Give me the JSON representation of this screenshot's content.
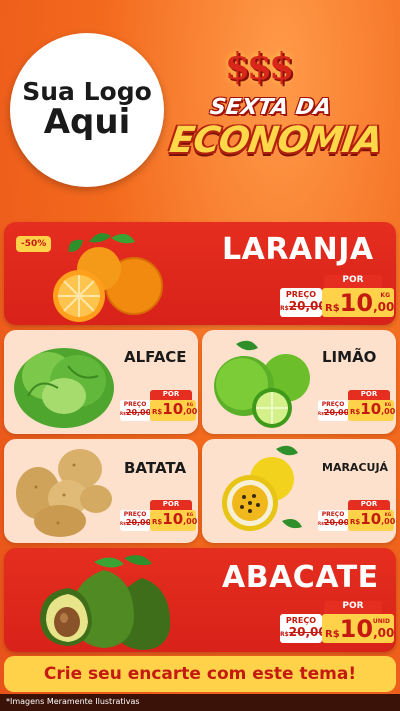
{
  "logo": {
    "line1": "Sua Logo",
    "line2": "Aqui"
  },
  "header": {
    "dollars": "$$$",
    "line1": "SEXTA DA",
    "line2": "ECONOMIA"
  },
  "products": {
    "laranja": {
      "name": "LARANJA",
      "badge": "-50%",
      "preco_label": "PREÇO",
      "old_prefix": "R$",
      "old_price": "20,00",
      "por_label": "POR",
      "currency": "R$",
      "price_int": "10",
      "price_dec": ",00",
      "unit": "KG"
    },
    "alface": {
      "name": "ALFACE",
      "preco_label": "PREÇO",
      "old_prefix": "R$",
      "old_price": "20,00",
      "por_label": "POR",
      "currency": "R$",
      "price_int": "10",
      "price_dec": ",00",
      "unit": "KG"
    },
    "limao": {
      "name": "LIMÃO",
      "preco_label": "PREÇO",
      "old_prefix": "R$",
      "old_price": "20,00",
      "por_label": "POR",
      "currency": "R$",
      "price_int": "10",
      "price_dec": ",00",
      "unit": "KG"
    },
    "batata": {
      "name": "BATATA",
      "preco_label": "PREÇO",
      "old_prefix": "R$",
      "old_price": "20,00",
      "por_label": "POR",
      "currency": "R$",
      "price_int": "10",
      "price_dec": ",00",
      "unit": "KG"
    },
    "maracuja": {
      "name": "MARACUJÁ",
      "preco_label": "PREÇO",
      "old_prefix": "R$",
      "old_price": "20,00",
      "por_label": "POR",
      "currency": "R$",
      "price_int": "10",
      "price_dec": ",00",
      "unit": "KG"
    },
    "abacate": {
      "name": "ABACATE",
      "preco_label": "PREÇO",
      "old_prefix": "R$",
      "old_price": "20,00",
      "por_label": "POR",
      "currency": "R$",
      "price_int": "10",
      "price_dec": ",00",
      "unit": "UNID"
    }
  },
  "cta": "Crie seu encarte com este tema!",
  "footer": "*Imagens Meramente Ilustrativas",
  "colors": {
    "background": "#f36a1d",
    "card_red": "#e52e1f",
    "card_pink": "#fde1cc",
    "yellow": "#ffd24a",
    "dark_red": "#c41a10"
  },
  "icons": [
    "orange-icon",
    "lettuce-icon",
    "lime-icon",
    "potato-icon",
    "passion-fruit-icon",
    "avocado-icon"
  ]
}
